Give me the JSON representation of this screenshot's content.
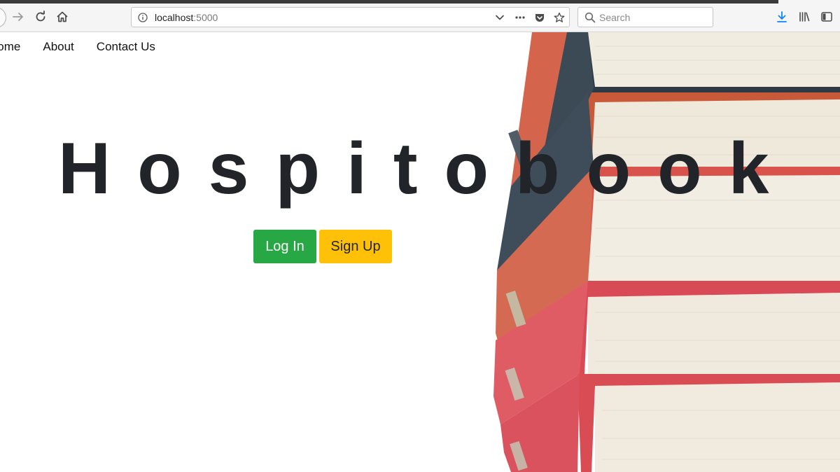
{
  "browser": {
    "url_host": "localhost",
    "url_port": ":5000",
    "search_placeholder": "Search"
  },
  "nav": {
    "items": [
      {
        "label": "Home"
      },
      {
        "label": "About"
      },
      {
        "label": "Contact Us"
      }
    ]
  },
  "hero": {
    "title": "Hospitobook",
    "login_label": "Log In",
    "signup_label": "Sign Up"
  },
  "icons": [
    "back-icon",
    "forward-icon",
    "reload-icon",
    "home-icon",
    "info-icon",
    "chevron-down-icon",
    "more-icon",
    "pocket-icon",
    "star-icon",
    "search-icon",
    "download-icon",
    "library-icon",
    "sidebar-icon"
  ],
  "colors": {
    "login_button": "#28a745",
    "signup_button": "#ffc107",
    "title": "#212529",
    "download_icon": "#0a84ff"
  }
}
